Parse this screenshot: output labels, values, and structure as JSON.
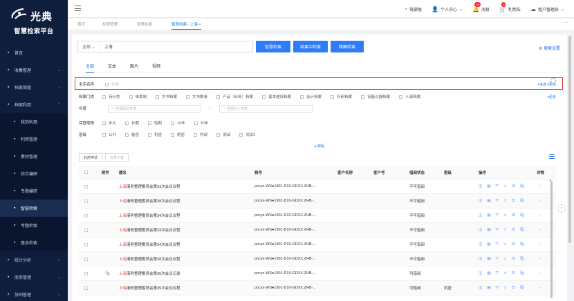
{
  "brand": {
    "logo_text": "光典",
    "platform_name": "智慧检索平台"
  },
  "sidebar": {
    "items": [
      {
        "label": "首页",
        "icon": "home-icon"
      },
      {
        "label": "收集整理",
        "icon": "folder-icon",
        "chevron": "⌄"
      },
      {
        "label": "档案保管",
        "icon": "bank-icon",
        "chevron": "⌄"
      },
      {
        "label": "档案利用",
        "icon": "archive-icon",
        "chevron": "⌃"
      },
      {
        "label": "我的利用",
        "icon": "doc-icon",
        "sub": true
      },
      {
        "label": "利用管理",
        "icon": "book-icon",
        "sub": true
      },
      {
        "label": "素材管理",
        "icon": "image-icon",
        "sub": true
      },
      {
        "label": "综合编研",
        "icon": "edit-icon",
        "sub": true
      },
      {
        "label": "专题编研",
        "icon": "topic-icon",
        "sub": true
      },
      {
        "label": "智慧检索",
        "icon": "search-icon",
        "sub": true,
        "active": true
      },
      {
        "label": "专题检索",
        "icon": "target-icon",
        "sub": true
      },
      {
        "label": "基本检索",
        "icon": "plus-search-icon",
        "sub": true
      },
      {
        "label": "统计分析",
        "icon": "chart-icon",
        "chevron": "⌄"
      },
      {
        "label": "库房管理",
        "icon": "warehouse-icon",
        "chevron": "⌄"
      },
      {
        "label": "协同管理",
        "icon": "collab-icon",
        "chevron": "⌄"
      }
    ]
  },
  "topbar": {
    "items": [
      {
        "label": "驾驶舱",
        "icon": "dashboard-icon"
      },
      {
        "label": "个人中心",
        "icon": "user-icon",
        "chevron": "⌄"
      },
      {
        "label": "消息",
        "icon": "bell-icon",
        "badge": "16"
      },
      {
        "label": "利用车",
        "icon": "cart-icon",
        "badge": "0"
      },
      {
        "label": "租户管理员",
        "icon": "cloud-icon",
        "chevron": "⌄"
      }
    ]
  },
  "tabs": {
    "items": [
      {
        "label": "首页"
      },
      {
        "label": "权限管理"
      },
      {
        "label": "智慧检索"
      },
      {
        "label": "智慧检索 - 上海  ×",
        "active": true
      }
    ],
    "more": "···"
  },
  "search": {
    "scope": "全部 ⌄",
    "query": "上海",
    "buttons": [
      "智慧检索",
      "结果中检索",
      "精确检索"
    ],
    "settings": "⚙ 搜索设置"
  },
  "type_tabs": [
    "全部",
    "文本",
    "图片",
    "视频"
  ],
  "filters": {
    "fonds": {
      "label": "全宗名称",
      "option": "全部",
      "multi": "+多选",
      "more": "▾更多"
    },
    "category": {
      "label": "档案门类",
      "options": [
        "待分类",
        "单套制",
        "文书档案",
        "文书案卷",
        "产品（业务）档案",
        "基本建设档案",
        "会计档案",
        "科研档案",
        "设备仪器档案",
        "人事档案"
      ],
      "more": "▾更多"
    },
    "year": {
      "label": "年度",
      "start_placeholder": "选择起始年度",
      "end_placeholder": "选择终止年度",
      "dash": "-"
    },
    "retention": {
      "label": "保管期限",
      "options": [
        "永久",
        "长期",
        "短期",
        "10年",
        "30年"
      ]
    },
    "secrecy": {
      "label": "密级",
      "options": [
        "公开",
        "秘密",
        "机密",
        "绝密",
        "内部",
        "测试",
        "测试2"
      ]
    },
    "collapse": "▴ 收起"
  },
  "actions": {
    "apply": "利用申请",
    "download": "批量下载"
  },
  "table": {
    "headers": {
      "attach": "附件",
      "title": "题名",
      "code": "档号",
      "client_name": "客户名称",
      "client_no": "客户号",
      "borrow": "借阅状态",
      "secret": "密级",
      "ops": "操作",
      "detail": "详情"
    },
    "ops_icons": "◫ ▤ ⛉ ☆ ⛫ ⧉",
    "rows": [
      {
        "title_hl": "上海",
        "title_rest": "港务整理委员会第33次会议议程",
        "code": "pocys-WS●1901-D10-GDXX.ZHB-...",
        "borrow": "不可借阅",
        "secret": "",
        "attach": ""
      },
      {
        "title_hl": "上海",
        "title_rest": "港务整理委员会第38次会议议程",
        "code": "pocys-WS●1901-D10-GDXX.ZHB-...",
        "borrow": "不可借阅",
        "secret": "",
        "attach": ""
      },
      {
        "title_hl": "上海",
        "title_rest": "港务整理委员会第34次会议议程",
        "code": "pocys-WS●1901-D10-GDXX.ZHB-...",
        "borrow": "不可借阅",
        "secret": "",
        "attach": ""
      },
      {
        "title_hl": "上海",
        "title_rest": "港务整理委员会第33次会议议程",
        "code": "pocys-WS●1901-D10-GDXX.ZHB-...",
        "borrow": "不可借阅",
        "secret": "",
        "attach": ""
      },
      {
        "title_hl": "上海",
        "title_rest": "港务整理委员会第34次会议议程",
        "code": "pocys-WS●1901-D10-GDXX.ZHB-...",
        "borrow": "不可借阅",
        "secret": "",
        "attach": ""
      },
      {
        "title_hl": "上海",
        "title_rest": "港务整理委员会第38次会议议程",
        "code": "pocys-WS●1901-D10-GDXX.ZHB-...",
        "borrow": "不可借阅",
        "secret": "",
        "attach": ""
      },
      {
        "title_hl": "上海",
        "title_rest": "港务整理委员会第36次会议记录",
        "code": "pocys-WS●1901-D10-GDXX.ZHB-...",
        "borrow": "可借阅",
        "secret": "",
        "attach": "📎"
      },
      {
        "title_hl": "上海",
        "title_rest": "港务整理委员会第35次会议议程",
        "code": "pocys-WS●1901-D10-GDXX.ZHB-...",
        "borrow": "可借阅",
        "secret": "机密",
        "attach": ""
      }
    ]
  }
}
